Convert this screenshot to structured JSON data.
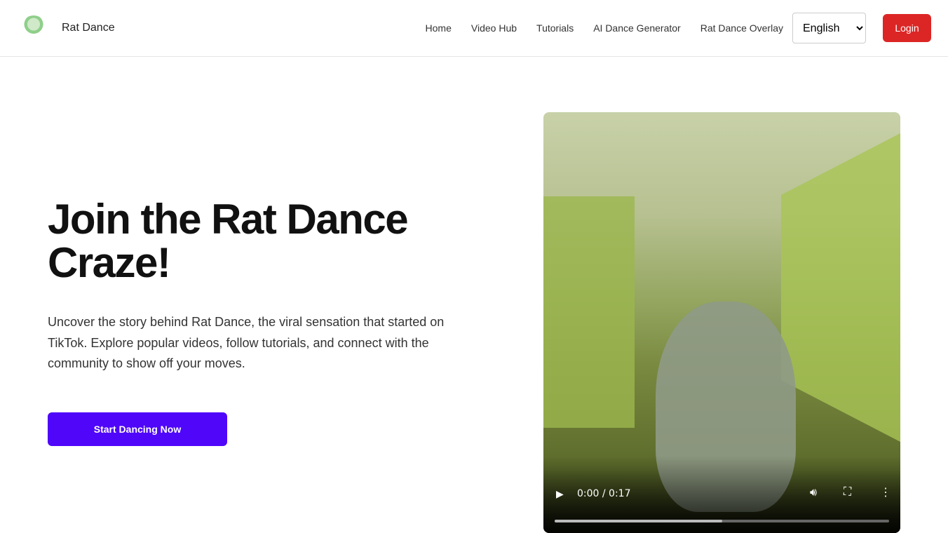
{
  "header": {
    "brand": "Rat Dance",
    "nav": [
      "Home",
      "Video Hub",
      "Tutorials",
      "AI Dance Generator",
      "Rat Dance Overlay"
    ],
    "language": "English",
    "login": "Login"
  },
  "hero": {
    "title": "Join the Rat Dance Craze!",
    "description": "Uncover the story behind Rat Dance, the viral sensation that started on TikTok. Explore popular videos, follow tutorials, and connect with the community to show off your moves.",
    "cta": "Start Dancing Now"
  },
  "video": {
    "time": "0:00 / 0:17",
    "buffered_fraction": 0.5
  },
  "colors": {
    "login": "#dc2626",
    "cta": "#4f06f9"
  }
}
